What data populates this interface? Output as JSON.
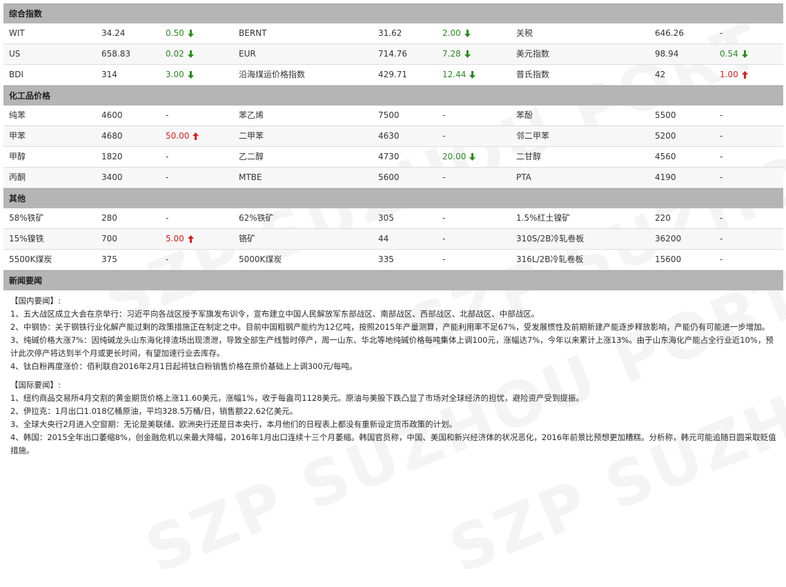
{
  "sections": {
    "index": "综合指数",
    "chem": "化工品价格",
    "other": "其他",
    "news": "新闻要闻"
  },
  "colors": {
    "up": "#d42020",
    "down": "#2a8a1e",
    "header_bg": "#b5b5b5"
  },
  "watermark": "SZP SUZHOU PORT",
  "index_rows": [
    [
      {
        "n": "WIT",
        "v": "34.24",
        "c": "0.50",
        "d": "down"
      },
      {
        "n": "BERNT",
        "v": "31.62",
        "c": "2.00",
        "d": "down"
      },
      {
        "n": "关税",
        "v": "646.26",
        "c": "-",
        "d": ""
      }
    ],
    [
      {
        "n": "US",
        "v": "658.83",
        "c": "0.02",
        "d": "down"
      },
      {
        "n": "EUR",
        "v": "714.76",
        "c": "7.28",
        "d": "down"
      },
      {
        "n": "美元指数",
        "v": "98.94",
        "c": "0.54",
        "d": "down"
      }
    ],
    [
      {
        "n": "BDI",
        "v": "314",
        "c": "3.00",
        "d": "down"
      },
      {
        "n": "沿海煤运价格指数",
        "v": "429.71",
        "c": "12.44",
        "d": "down"
      },
      {
        "n": "普氏指数",
        "v": "42",
        "c": "1.00",
        "d": "up"
      }
    ]
  ],
  "chem_rows": [
    [
      {
        "n": "纯苯",
        "v": "4600",
        "c": "-",
        "d": ""
      },
      {
        "n": "苯乙烯",
        "v": "7500",
        "c": "-",
        "d": ""
      },
      {
        "n": "苯酚",
        "v": "5500",
        "c": "-",
        "d": ""
      }
    ],
    [
      {
        "n": "甲苯",
        "v": "4680",
        "c": "50.00",
        "d": "up"
      },
      {
        "n": "二甲苯",
        "v": "4630",
        "c": "-",
        "d": ""
      },
      {
        "n": "邻二甲苯",
        "v": "5200",
        "c": "-",
        "d": ""
      }
    ],
    [
      {
        "n": "甲醇",
        "v": "1820",
        "c": "-",
        "d": ""
      },
      {
        "n": "乙二醇",
        "v": "4730",
        "c": "20.00",
        "d": "down"
      },
      {
        "n": "二甘醇",
        "v": "4560",
        "c": "-",
        "d": ""
      }
    ],
    [
      {
        "n": "丙酮",
        "v": "3400",
        "c": "-",
        "d": ""
      },
      {
        "n": "MTBE",
        "v": "5600",
        "c": "-",
        "d": ""
      },
      {
        "n": "PTA",
        "v": "4190",
        "c": "-",
        "d": ""
      }
    ]
  ],
  "other_rows": [
    [
      {
        "n": "58%铁矿",
        "v": "280",
        "c": "-",
        "d": ""
      },
      {
        "n": "62%铁矿",
        "v": "305",
        "c": "-",
        "d": ""
      },
      {
        "n": "1.5%红土镍矿",
        "v": "220",
        "c": "-",
        "d": ""
      }
    ],
    [
      {
        "n": "15%镍铁",
        "v": "700",
        "c": "5.00",
        "d": "up"
      },
      {
        "n": "铬矿",
        "v": "44",
        "c": "-",
        "d": ""
      },
      {
        "n": "310S/2B冷轧卷板",
        "v": "36200",
        "c": "-",
        "d": ""
      }
    ],
    [
      {
        "n": "5500K煤炭",
        "v": "375",
        "c": "-",
        "d": ""
      },
      {
        "n": "5000K煤炭",
        "v": "335",
        "c": "-",
        "d": ""
      },
      {
        "n": "316L/2B冷轧卷板",
        "v": "15600",
        "c": "-",
        "d": ""
      }
    ]
  ],
  "news": {
    "domestic_title": "【国内要闻】:",
    "domestic": [
      "1、五大战区成立大会在京举行：习近平向各战区授予军旗发布训令，宣布建立中国人民解放军东部战区、南部战区、西部战区、北部战区、中部战区。",
      "2、中钢协：关于钢铁行业化解产能过剩的政策措施正在制定之中。目前中国粗钢产能约为12亿吨，按照2015年产量测算，产能利用率不足67%，受发展惯性及前期新建产能逐步释放影响，产能仍有可能进一步增加。",
      "3、纯碱价格大涨7%：因纯碱龙头山东海化排渣场出现溃泄，导致全部生产线暂时停产，周一山东、华北等地纯碱价格每吨集体上调100元，涨幅达7%，今年以来累计上涨13%。由于山东海化产能占全行业近10%，预计此次停产将达到半个月或更长时间，有望加速行业去库存。",
      "4、钛白粉再度涨价：佰利联自2016年2月1日起将钛白粉销售价格在原价基础上上调300元/每吨。"
    ],
    "intl_title": "【国际要闻】:",
    "intl": [
      "1、纽约商品交易所4月交割的黄金期货价格上涨11.60美元，涨幅1%，收于每盎司1128美元。原油与美股下跌凸显了市场对全球经济的担忧，避险资产受到提振。",
      "2、伊拉克：1月出口1.018亿桶原油，平均328.5万桶/日，销售额22.62亿美元。",
      "3、全球大央行2月进入空窗期：无论是美联储、欧洲央行还是日本央行，本月他们的日程表上都没有重新设定货币政策的计划。",
      "4、韩国：2015全年出口萎缩8%，创金融危机以来最大降幅，2016年1月出口连续十三个月萎缩。韩国官员称，中国、美国和新兴经济体的状况恶化，2016年前景比预想更加糟糕。分析称，韩元可能追随日圆采取贬值措施。"
    ]
  }
}
